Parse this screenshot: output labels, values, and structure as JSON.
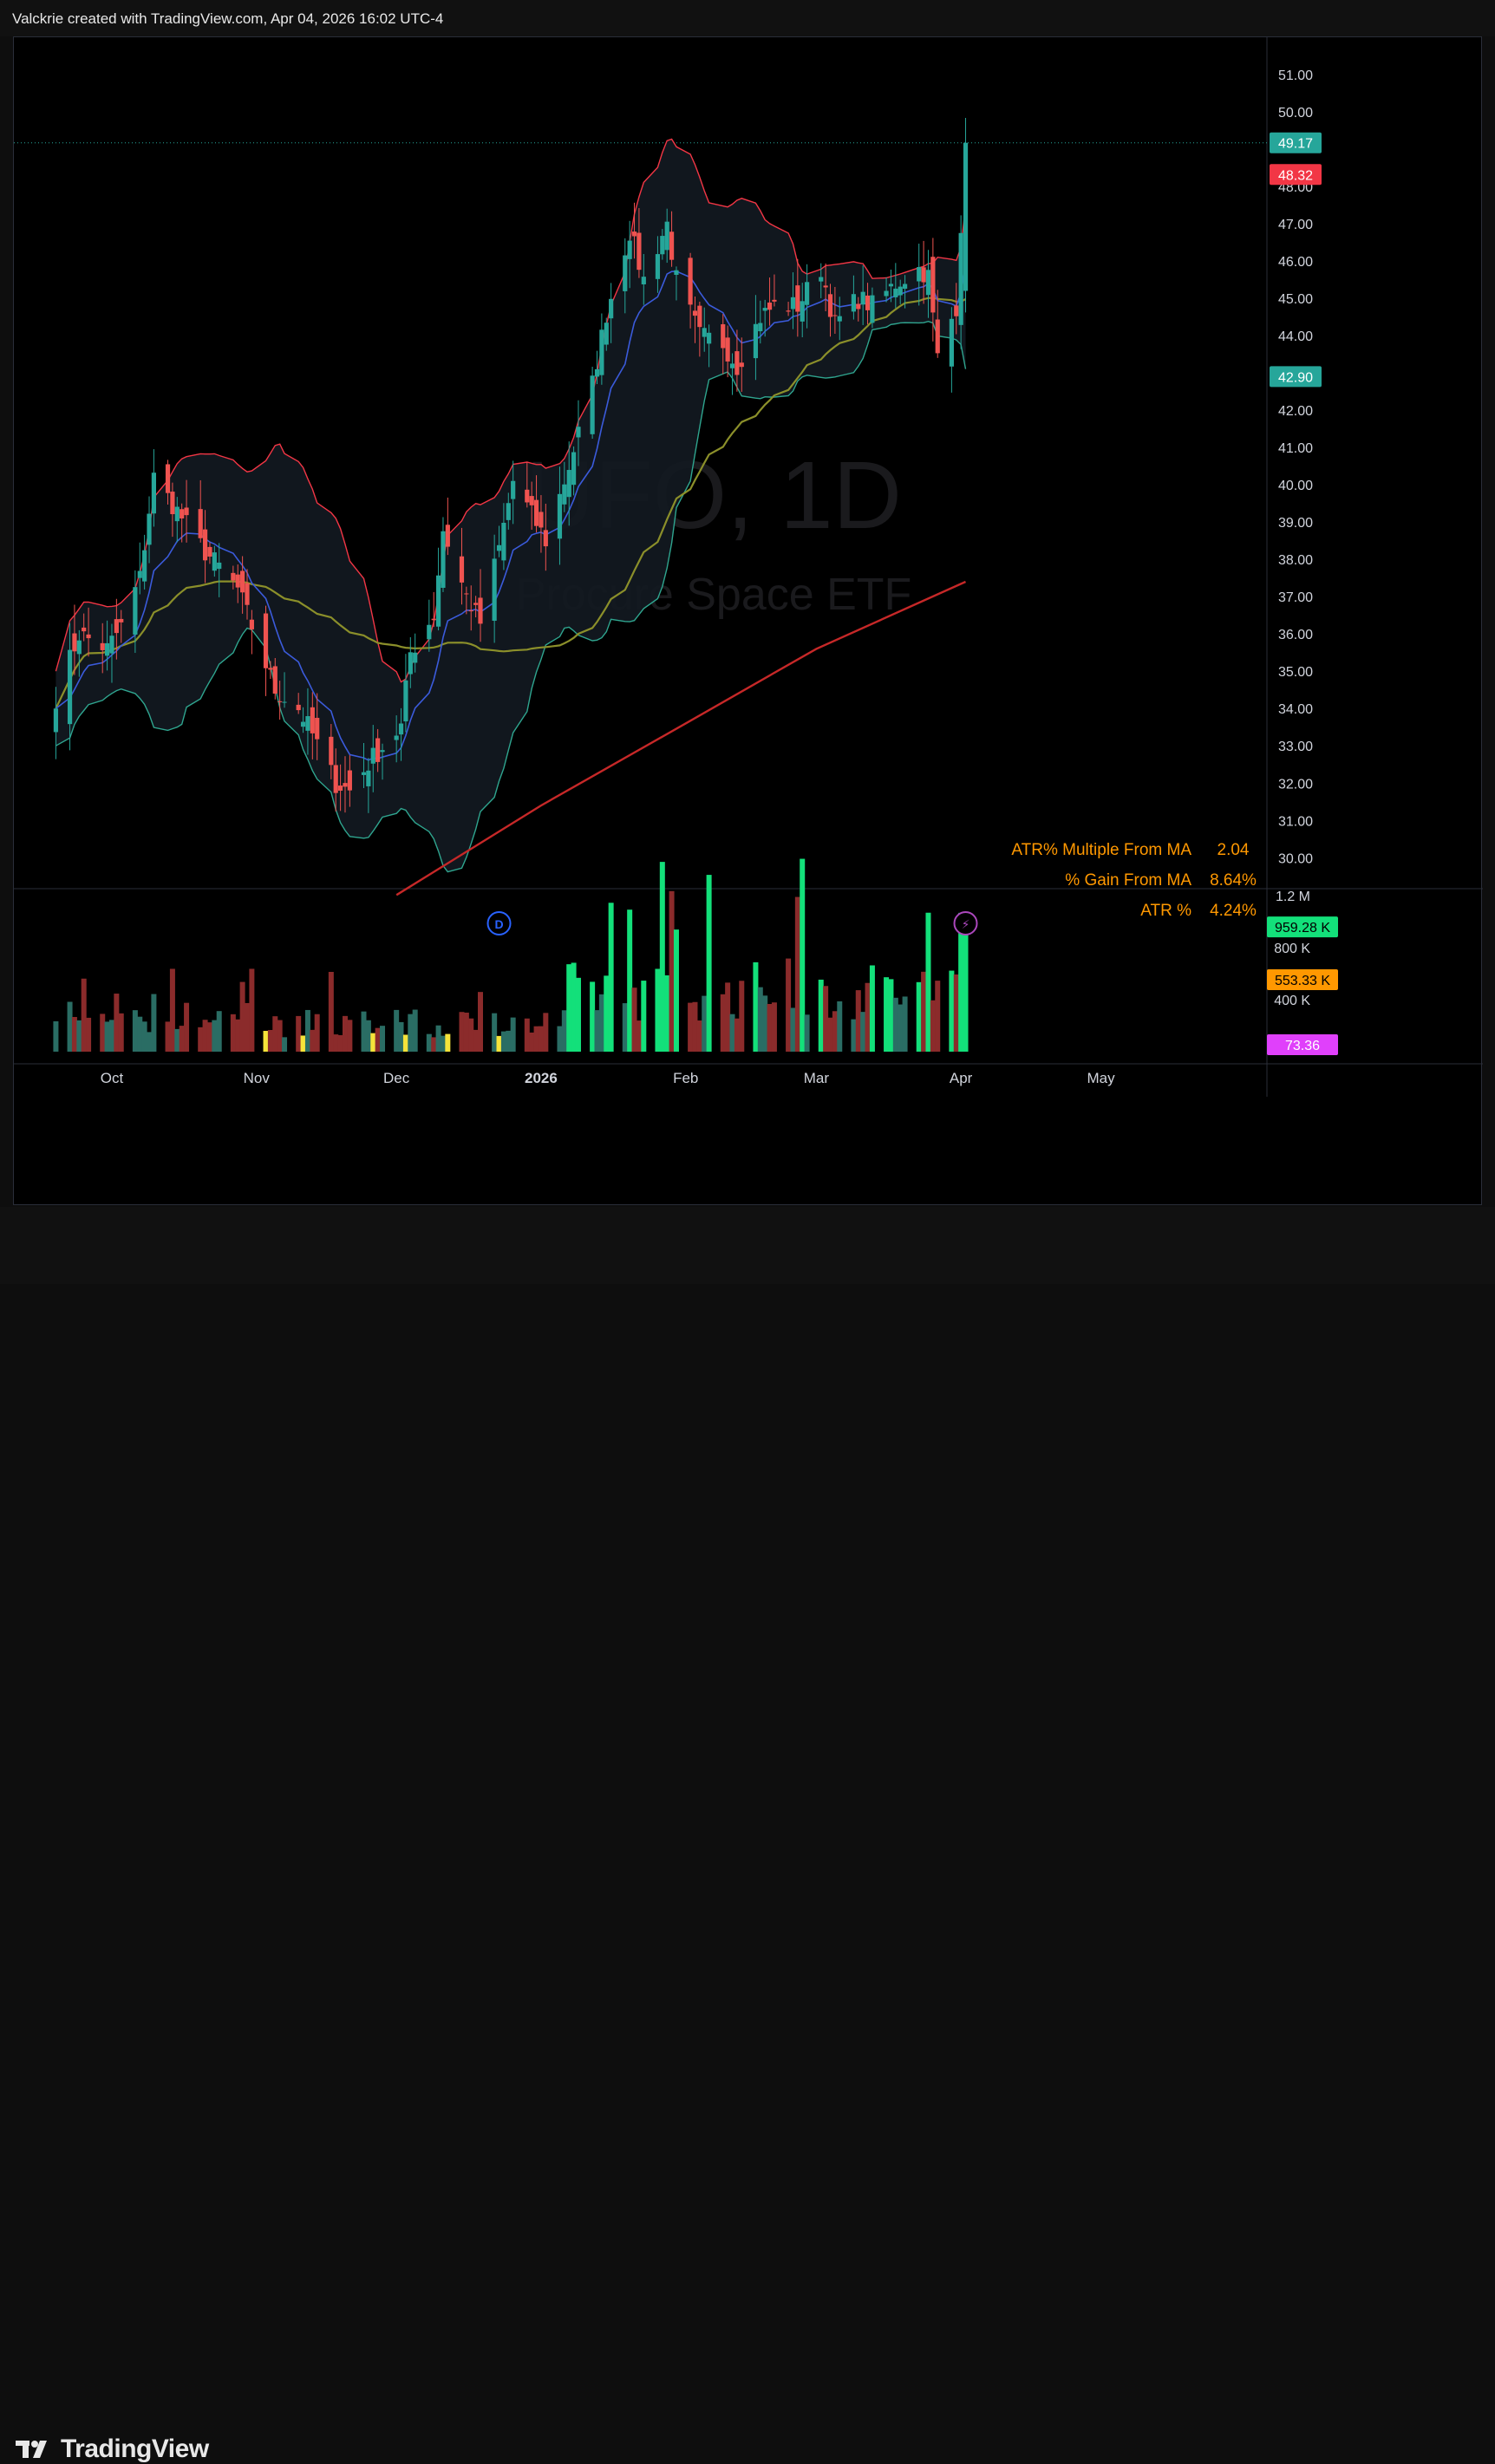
{
  "header": {
    "caption": "Valckrie created with TradingView.com, Apr 04, 2026 16:02 UTC-4"
  },
  "watermark": {
    "symbol": "UFO, 1D",
    "name": "Procure Space ETF"
  },
  "footer": {
    "brand": "TradingView"
  },
  "colors": {
    "up": "#26a69a",
    "down": "#ef5350",
    "bb_upper": "#f23645",
    "bb_lower": "#2fa58f",
    "ema_fast": "#3b5bdb",
    "sma_mid": "#8b8f2a",
    "sma_long": "#c62828",
    "vol_green": "#13e07a",
    "vol_red": "#8b2b2b",
    "vol_teal": "#2a6d64",
    "vol_yellow": "#f5e33a"
  },
  "stats": [
    {
      "label": "ATR% Multiple From MA",
      "value": "2.04"
    },
    {
      "label": "% Gain From MA",
      "value": "8.64%"
    },
    {
      "label": "ATR %",
      "value": "4.24%"
    }
  ],
  "price_badges": [
    {
      "value": "49.17",
      "color": "#26a69a"
    },
    {
      "value": "48.32",
      "color": "#f23645"
    },
    {
      "value": "42.90",
      "color": "#26a69a"
    }
  ],
  "volume_badges": [
    {
      "value": "959.28 K",
      "color": "#13e07a",
      "text_color": "#000000"
    },
    {
      "value": "553.33 K",
      "color": "#ff9800",
      "text_color": "#000000"
    },
    {
      "value": "73.36",
      "color": "#e040fb",
      "text_color": "#ffffff"
    }
  ],
  "events": [
    {
      "label": "D"
    },
    {
      "label": "⚡"
    }
  ],
  "chart_data": {
    "type": "candlestick",
    "symbol": "UFO",
    "interval": "1D",
    "ylim": [
      29.1,
      52.0
    ],
    "y_ticks": [
      "51.00",
      "50.00",
      "48.00",
      "47.00",
      "46.00",
      "45.00",
      "44.00",
      "42.00",
      "41.00",
      "40.00",
      "39.00",
      "38.00",
      "37.00",
      "36.00",
      "35.00",
      "34.00",
      "33.00",
      "32.00",
      "31.00",
      "30.00"
    ],
    "x_ticks": [
      "Oct",
      "Nov",
      "Dec",
      "2026",
      "Feb",
      "Mar",
      "Apr",
      "May"
    ],
    "volume_ticks": [
      "1.2 M",
      "800 K",
      "400 K"
    ],
    "volume_max": 1200000,
    "close_anchors": [
      [
        "2025-09-19",
        34.3
      ],
      [
        "2025-09-24",
        36.0
      ],
      [
        "2025-09-30",
        35.6
      ],
      [
        "2025-10-03",
        36.2
      ],
      [
        "2025-10-07",
        37.5
      ],
      [
        "2025-10-10",
        40.2
      ],
      [
        "2025-10-15",
        39.3
      ],
      [
        "2025-10-21",
        38.2
      ],
      [
        "2025-10-24",
        37.8
      ],
      [
        "2025-10-28",
        37.2
      ],
      [
        "2025-10-31",
        36.2
      ],
      [
        "2025-11-05",
        34.5
      ],
      [
        "2025-11-10",
        34.0
      ],
      [
        "2025-11-13",
        33.3
      ],
      [
        "2025-11-18",
        32.0
      ],
      [
        "2025-11-21",
        31.8
      ],
      [
        "2025-11-26",
        32.7
      ],
      [
        "2025-12-02",
        33.5
      ],
      [
        "2025-12-04",
        35.5
      ],
      [
        "2025-12-09",
        36.5
      ],
      [
        "2025-12-11",
        38.8
      ],
      [
        "2025-12-16",
        37.0
      ],
      [
        "2025-12-19",
        36.3
      ],
      [
        "2025-12-23",
        38.3
      ],
      [
        "2025-12-26",
        40.1
      ],
      [
        "2026-01-02",
        38.5
      ],
      [
        "2026-01-07",
        40.5
      ],
      [
        "2026-01-12",
        42.7
      ],
      [
        "2026-01-15",
        44.6
      ],
      [
        "2026-01-20",
        46.8
      ],
      [
        "2026-01-23",
        45.5
      ],
      [
        "2026-01-28",
        47.0
      ],
      [
        "2026-01-30",
        45.5
      ],
      [
        "2026-02-04",
        44.0
      ],
      [
        "2026-02-09",
        43.8
      ],
      [
        "2026-02-12",
        43.2
      ],
      [
        "2026-02-17",
        44.5
      ],
      [
        "2026-02-20",
        44.8
      ],
      [
        "2026-02-25",
        44.8
      ],
      [
        "2026-03-02",
        45.8
      ],
      [
        "2026-03-05",
        44.3
      ],
      [
        "2026-03-10",
        45.0
      ],
      [
        "2026-03-13",
        44.8
      ],
      [
        "2026-03-18",
        45.4
      ],
      [
        "2026-03-23",
        45.8
      ],
      [
        "2026-03-25",
        45.6
      ],
      [
        "2026-03-27",
        43.4
      ],
      [
        "2026-03-31",
        44.8
      ],
      [
        "2026-04-02",
        49.17
      ]
    ],
    "sma200_line": [
      [
        "2025-12-01",
        29.0
      ],
      [
        "2026-01-01",
        31.4
      ],
      [
        "2026-02-01",
        33.6
      ],
      [
        "2026-03-01",
        35.6
      ],
      [
        "2026-04-02",
        37.4
      ]
    ],
    "last_close": 49.17,
    "bb_upper_last": 48.32,
    "bb_lower_last": 42.9,
    "last_volume": 959280,
    "volume_ma": 553330
  }
}
